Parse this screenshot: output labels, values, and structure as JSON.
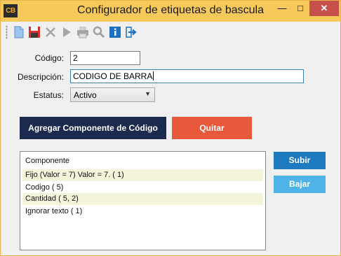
{
  "window": {
    "icon_text": "CB",
    "title": "Configurador de etiquetas de bascula"
  },
  "toolbar": {
    "buttons": [
      "new-file-icon",
      "save-icon",
      "delete-icon",
      "play-icon",
      "print-icon",
      "search-icon",
      "info-icon",
      "exit-icon"
    ]
  },
  "form": {
    "codigo_label": "Código:",
    "codigo_value": "2",
    "descripcion_label": "Descripción:",
    "descripcion_value": "CODIGO DE BARRA",
    "estatus_label": "Estatus:",
    "estatus_value": "Activo"
  },
  "actions": {
    "add_component_label": "Agregar Componente de Código",
    "remove_label": "Quitar",
    "up_label": "Subir",
    "down_label": "Bajar"
  },
  "components": {
    "header": "Componente",
    "rows": [
      "Fijo (Valor = 7)  Valor = 7.  ( 1)",
      "Codigo  ( 5)",
      "Cantidad  ( 5, 2)",
      "Ignorar texto  ( 1)"
    ]
  },
  "colors": {
    "titlebar": "#f7c85a",
    "add_button": "#1b2a4e",
    "remove_button": "#e8583b",
    "up_button": "#1e7bc0",
    "down_button": "#4fb3e8"
  }
}
